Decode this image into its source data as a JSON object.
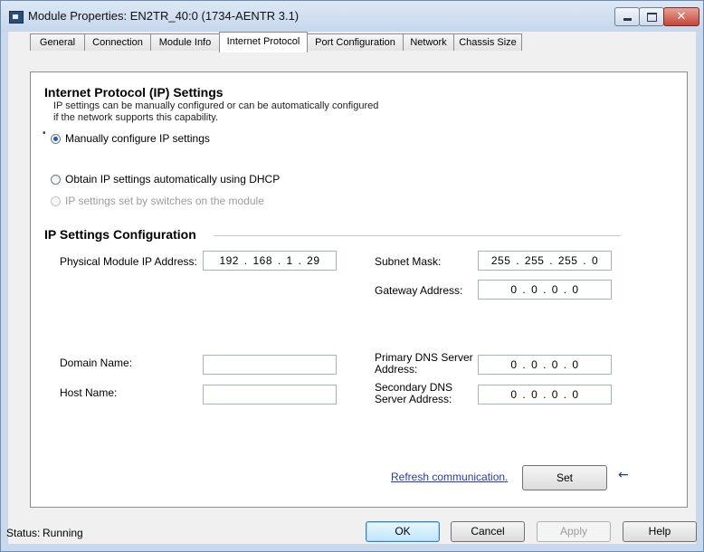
{
  "window": {
    "title": "Module Properties: EN2TR_40:0 (1734-AENTR 3.1)",
    "close_glyph": "✕"
  },
  "tabs": [
    {
      "label": "General"
    },
    {
      "label": "Connection"
    },
    {
      "label": "Module Info"
    },
    {
      "label": "Internet Protocol",
      "active": true
    },
    {
      "label": "Port Configuration"
    },
    {
      "label": "Network"
    },
    {
      "label": "Chassis Size"
    }
  ],
  "ip_settings": {
    "heading": "Internet Protocol (IP) Settings",
    "description_line1": "IP settings can be manually configured or can be automatically configured",
    "description_line2": "if the network supports this capability.",
    "options": [
      {
        "label": "Manually configure IP settings",
        "selected": true,
        "enabled": true
      },
      {
        "label": "Obtain IP settings automatically using DHCP",
        "selected": false,
        "enabled": true
      },
      {
        "label": "IP settings set by switches on the module",
        "selected": false,
        "enabled": false
      }
    ]
  },
  "config": {
    "heading": "IP Settings Configuration",
    "ip_label": "Physical Module IP Address:",
    "ip_value": "192 . 168 .  1  .  29",
    "subnet_label": "Subnet Mask:",
    "subnet_value": "255 . 255 . 255 .  0",
    "gateway_label": "Gateway Address:",
    "gateway_value": "0  .  0  .  0  .  0",
    "domain_label": "Domain Name:",
    "domain_value": "",
    "host_label": "Host Name:",
    "host_value": "",
    "primary_dns_label_1": "Primary DNS Server",
    "primary_dns_label_2": "Address:",
    "primary_dns_value": "0  .  0  .  0  .  0",
    "secondary_dns_label_1": "Secondary DNS",
    "secondary_dns_label_2": "Server Address:",
    "secondary_dns_value": "0  .  0  .  0  .  0",
    "refresh_link": "Refresh communication.",
    "set_button": "Set"
  },
  "footer": {
    "status_label": "Status:",
    "status_value": "Running",
    "ok": "OK",
    "cancel": "Cancel",
    "apply": "Apply",
    "help": "Help"
  },
  "colors": {
    "title_bar": "#c6d7ec",
    "link": "#2a3aa8",
    "close_button": "#c64636"
  }
}
